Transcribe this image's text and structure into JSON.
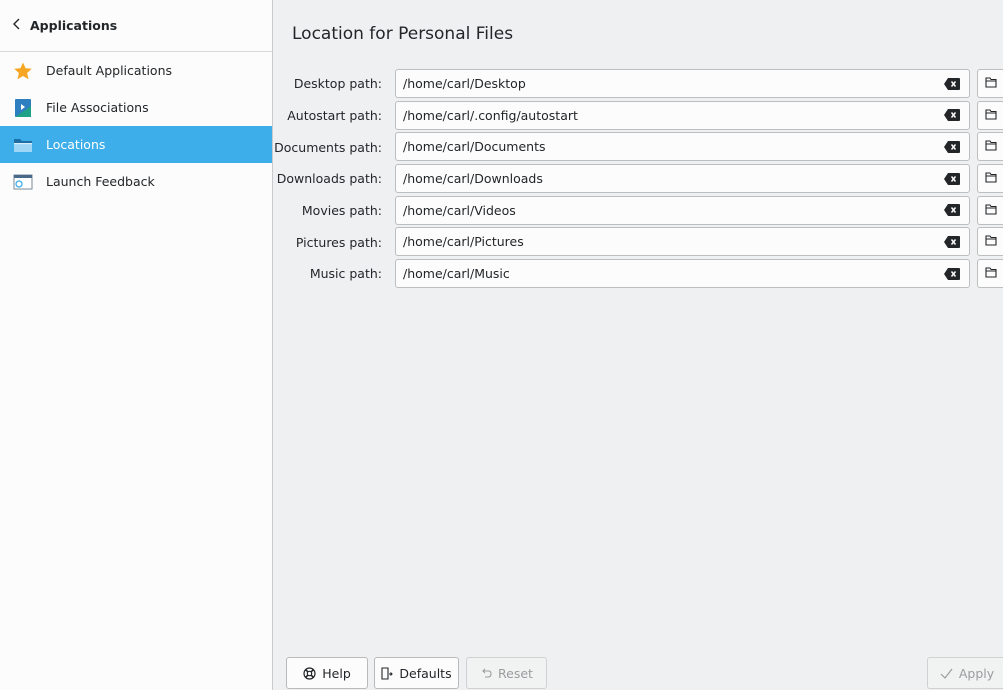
{
  "sidebar": {
    "back_label": "Applications",
    "items": [
      {
        "label": "Default Applications",
        "icon": "star-icon",
        "active": false
      },
      {
        "label": "File Associations",
        "icon": "file-associations-icon",
        "active": false
      },
      {
        "label": "Locations",
        "icon": "folder-icon",
        "active": true
      },
      {
        "label": "Launch Feedback",
        "icon": "launch-feedback-icon",
        "active": false
      }
    ]
  },
  "main": {
    "title": "Location for Personal Files",
    "paths": [
      {
        "label": "Desktop path:",
        "value": "/home/carl/Desktop"
      },
      {
        "label": "Autostart path:",
        "value": "/home/carl/.config/autostart"
      },
      {
        "label": "Documents path:",
        "value": "/home/carl/Documents"
      },
      {
        "label": "Downloads path:",
        "value": "/home/carl/Downloads"
      },
      {
        "label": "Movies path:",
        "value": "/home/carl/Videos"
      },
      {
        "label": "Pictures path:",
        "value": "/home/carl/Pictures"
      },
      {
        "label": "Music path:",
        "value": "/home/carl/Music"
      }
    ]
  },
  "buttons": {
    "help": "Help",
    "defaults": "Defaults",
    "reset": "Reset",
    "apply": "Apply"
  },
  "colors": {
    "accent": "#3daee9",
    "star": "#f6a623"
  }
}
